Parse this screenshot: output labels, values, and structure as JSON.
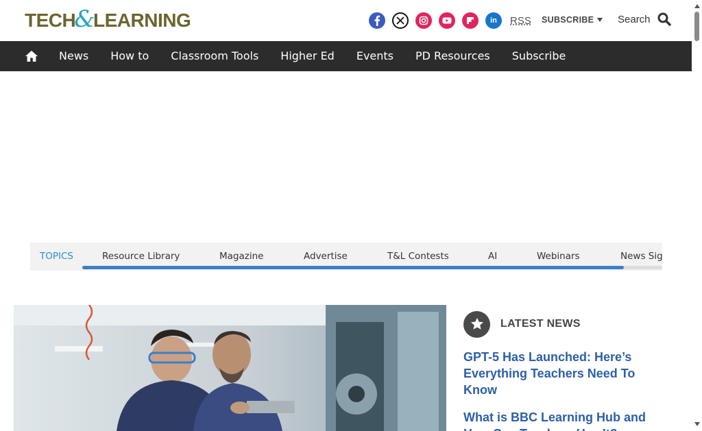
{
  "header": {
    "logo_left": "TECH",
    "logo_amp": "&",
    "logo_right": "LEARNING",
    "social_icons": [
      "facebook-icon",
      "x-icon",
      "instagram-icon",
      "youtube-icon",
      "flipboard-icon",
      "linkedin-icon"
    ],
    "rss_label": "RSS",
    "subscribe_label": "SUBSCRIBE",
    "search_label": "Search"
  },
  "nav": {
    "home_icon": "home-icon",
    "items": [
      "News",
      "How to",
      "Classroom Tools",
      "Higher Ed",
      "Events",
      "PD Resources",
      "Subscribe"
    ]
  },
  "topics": {
    "label": "TOPICS",
    "items": [
      "Resource Library",
      "Magazine",
      "Advertise",
      "T&L Contests",
      "AI",
      "Webinars",
      "News Sig"
    ]
  },
  "latest_news": {
    "title": "LATEST NEWS",
    "items": [
      "GPT-5 Has Launched: Here’s Everything Teachers Need To Know",
      "What is BBC Learning Hub and How Can Teachers Use It?"
    ]
  },
  "colors": {
    "nav_bg": "#2c2c2c",
    "link_blue": "#2d5fa8",
    "topics_accent": "#2a8fc7",
    "scroll_thumb": "#3a7fc8"
  }
}
